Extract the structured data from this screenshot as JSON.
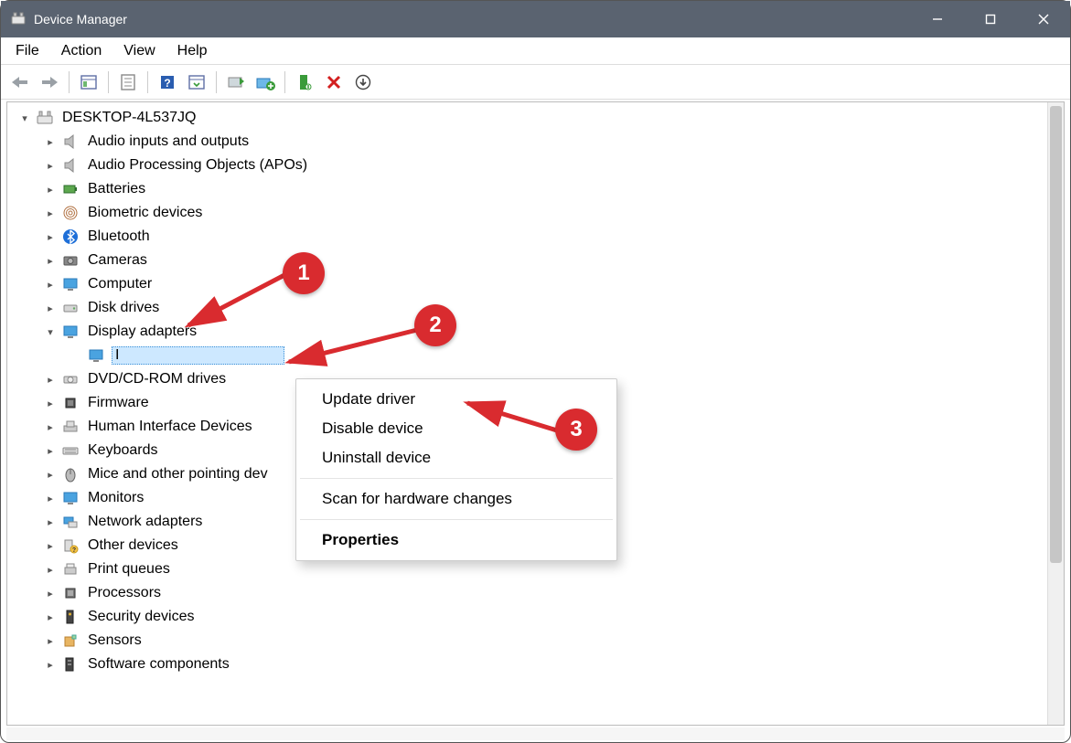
{
  "title": "Device Manager",
  "menus": {
    "file": "File",
    "action": "Action",
    "view": "View",
    "help": "Help"
  },
  "root": "DESKTOP-4L537JQ",
  "categories": [
    {
      "label": "Audio inputs and outputs",
      "icon": "speaker"
    },
    {
      "label": "Audio Processing Objects (APOs)",
      "icon": "speaker"
    },
    {
      "label": "Batteries",
      "icon": "battery"
    },
    {
      "label": "Biometric devices",
      "icon": "fingerprint"
    },
    {
      "label": "Bluetooth",
      "icon": "bluetooth"
    },
    {
      "label": "Cameras",
      "icon": "camera"
    },
    {
      "label": "Computer",
      "icon": "monitor"
    },
    {
      "label": "Disk drives",
      "icon": "disk"
    },
    {
      "label": "Display adapters",
      "icon": "monitor",
      "expanded": true,
      "children": [
        {
          "label": "I",
          "icon": "monitor",
          "selected": true
        }
      ]
    },
    {
      "label": "DVD/CD-ROM drives",
      "icon": "dvd"
    },
    {
      "label": "Firmware",
      "icon": "chip"
    },
    {
      "label": "Human Interface Devices",
      "icon": "hid"
    },
    {
      "label": "Keyboards",
      "icon": "keyboard"
    },
    {
      "label": "Mice and other pointing dev",
      "icon": "mouse"
    },
    {
      "label": "Monitors",
      "icon": "monitor"
    },
    {
      "label": "Network adapters",
      "icon": "network"
    },
    {
      "label": "Other devices",
      "icon": "unknown"
    },
    {
      "label": "Print queues",
      "icon": "printer"
    },
    {
      "label": "Processors",
      "icon": "cpu"
    },
    {
      "label": "Security devices",
      "icon": "security"
    },
    {
      "label": "Sensors",
      "icon": "sensor"
    },
    {
      "label": "Software components",
      "icon": "software"
    }
  ],
  "context_menu": {
    "update": "Update driver",
    "disable": "Disable device",
    "uninstall": "Uninstall device",
    "scan": "Scan for hardware changes",
    "properties": "Properties"
  },
  "annotations": {
    "1": "1",
    "2": "2",
    "3": "3"
  }
}
